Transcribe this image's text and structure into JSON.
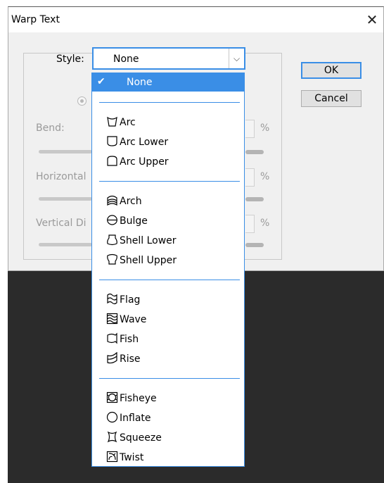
{
  "dialog": {
    "title": "Warp Text",
    "close_glyph": "✕",
    "style_label": "Style:",
    "style_value": "None",
    "arrow_glyph": "⌵",
    "ok_label": "OK",
    "cancel_label": "Cancel",
    "bend_label": "Bend:",
    "horizontal_label": "Horizontal",
    "vertical_label": "Vertical Di",
    "radio_label": "",
    "percent": "%"
  },
  "dropdown": {
    "selected": "None",
    "check_glyph": "✔",
    "groups": [
      [
        {
          "label": "Arc",
          "icon": "arc-icon"
        },
        {
          "label": "Arc Lower",
          "icon": "arc-lower-icon"
        },
        {
          "label": "Arc Upper",
          "icon": "arc-upper-icon"
        }
      ],
      [
        {
          "label": "Arch",
          "icon": "arch-icon"
        },
        {
          "label": "Bulge",
          "icon": "bulge-icon"
        },
        {
          "label": "Shell Lower",
          "icon": "shell-lower-icon"
        },
        {
          "label": "Shell Upper",
          "icon": "shell-upper-icon"
        }
      ],
      [
        {
          "label": "Flag",
          "icon": "flag-icon"
        },
        {
          "label": "Wave",
          "icon": "wave-icon"
        },
        {
          "label": "Fish",
          "icon": "fish-icon"
        },
        {
          "label": "Rise",
          "icon": "rise-icon"
        }
      ],
      [
        {
          "label": "Fisheye",
          "icon": "fisheye-icon"
        },
        {
          "label": "Inflate",
          "icon": "inflate-icon"
        },
        {
          "label": "Squeeze",
          "icon": "squeeze-icon"
        },
        {
          "label": "Twist",
          "icon": "twist-icon"
        }
      ]
    ]
  },
  "colors": {
    "accent": "#3a8ee6",
    "backdrop": "#2b2b2b",
    "dialog_bg": "#f0f0f0"
  }
}
